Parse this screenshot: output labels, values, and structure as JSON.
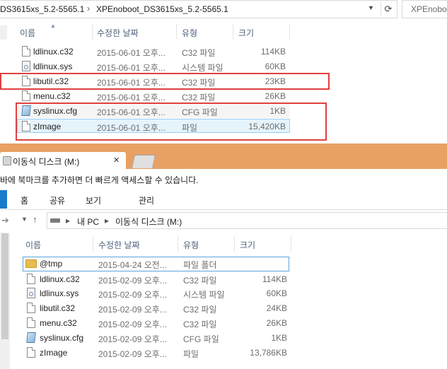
{
  "top_window": {
    "breadcrumbs": [
      "DS3615xs_5.2-5565.1",
      "XPEnoboot_DS3615xs_5.2-5565.1"
    ],
    "search_placeholder": "XPEnoboo",
    "columns": {
      "name": "이름",
      "date": "수정한 날짜",
      "type": "유형",
      "size": "크기"
    },
    "files": [
      {
        "name": "ldlinux.c32",
        "date": "2015-06-01 오후...",
        "type": "C32 파일",
        "size": "114KB",
        "icon": "file-icon"
      },
      {
        "name": "ldlinux.sys",
        "date": "2015-06-01 오후...",
        "type": "시스템 파일",
        "size": "60KB",
        "icon": "system-file-icon"
      },
      {
        "name": "libutil.c32",
        "date": "2015-06-01 오후...",
        "type": "C32 파일",
        "size": "23KB",
        "icon": "file-icon"
      },
      {
        "name": "menu.c32",
        "date": "2015-06-01 오후...",
        "type": "C32 파일",
        "size": "26KB",
        "icon": "file-icon"
      },
      {
        "name": "syslinux.cfg",
        "date": "2015-06-01 오후...",
        "type": "CFG 파일",
        "size": "1KB",
        "icon": "config-file-icon"
      },
      {
        "name": "zImage",
        "date": "2015-06-01 오후...",
        "type": "파일",
        "size": "15,420KB",
        "icon": "file-icon"
      }
    ]
  },
  "tabs": {
    "active_label": "이동식 디스크 (M:)",
    "close_glyph": "✕"
  },
  "bookmark_bar": {
    "text": "바에 북마크를 추가하면 더 빠르게 액세스할 수 있습니다."
  },
  "ribbon": {
    "tabs": [
      "홈",
      "공유",
      "보기",
      "관리"
    ]
  },
  "bottom_window": {
    "breadcrumbs": [
      "내 PC",
      "이동식 디스크 (M:)"
    ],
    "columns": {
      "name": "이름",
      "date": "수정한 날짜",
      "type": "유형",
      "size": "크기"
    },
    "files": [
      {
        "name": "@tmp",
        "date": "2015-04-24 오전...",
        "type": "파일 폴더",
        "size": "",
        "icon": "folder-icon"
      },
      {
        "name": "ldlinux.c32",
        "date": "2015-02-09 오후...",
        "type": "C32 파일",
        "size": "114KB",
        "icon": "file-icon"
      },
      {
        "name": "ldlinux.sys",
        "date": "2015-02-09 오후...",
        "type": "시스템 파일",
        "size": "60KB",
        "icon": "system-file-icon"
      },
      {
        "name": "libutil.c32",
        "date": "2015-02-09 오후...",
        "type": "C32 파일",
        "size": "24KB",
        "icon": "file-icon"
      },
      {
        "name": "menu.c32",
        "date": "2015-02-09 오후...",
        "type": "C32 파일",
        "size": "26KB",
        "icon": "file-icon"
      },
      {
        "name": "syslinux.cfg",
        "date": "2015-02-09 오후...",
        "type": "CFG 파일",
        "size": "1KB",
        "icon": "config-file-icon"
      },
      {
        "name": "zImage",
        "date": "2015-02-09 오후...",
        "type": "파일",
        "size": "13,786KB",
        "icon": "file-icon"
      }
    ]
  },
  "colors": {
    "highlight_box": "#e04040",
    "tab_bar": "#e8a064",
    "selection": "#e5f3fb",
    "ribbon_accent": "#1979ca"
  }
}
